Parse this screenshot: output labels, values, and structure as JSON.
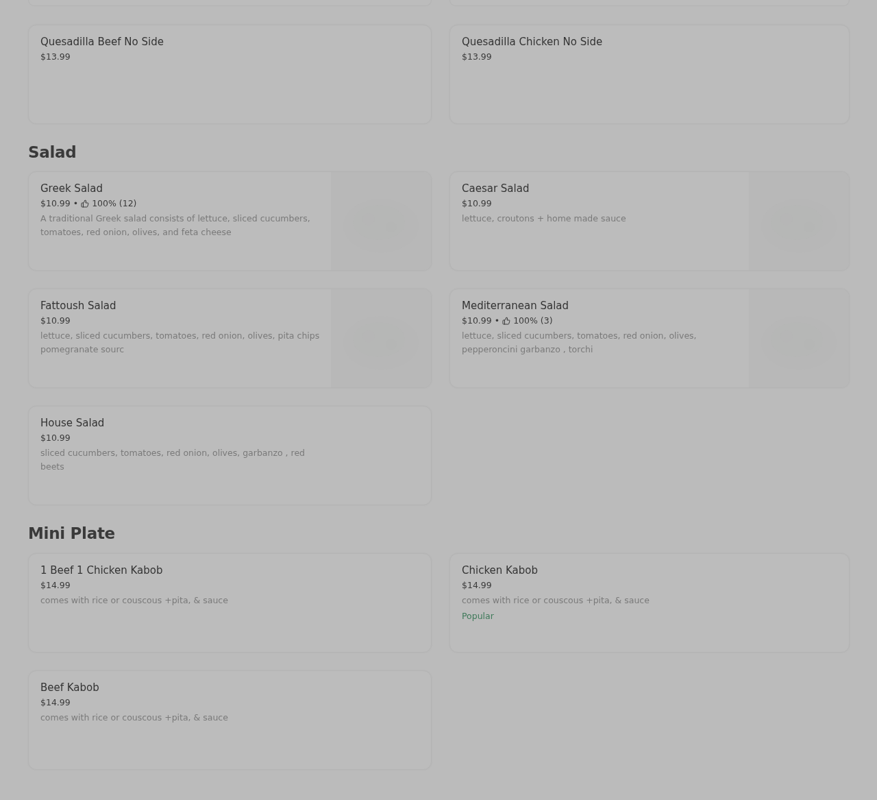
{
  "sections": [
    {
      "items": [
        {
          "name": "Quesadilla Beef No Side",
          "price": "$13.99"
        },
        {
          "name": "Quesadilla Chicken No Side",
          "price": "$13.99"
        }
      ]
    },
    {
      "title": "Salad",
      "items": [
        {
          "name": "Greek Salad",
          "price": "$10.99",
          "rating": {
            "separator": "•",
            "score": "100% (12)"
          },
          "description": "A traditional Greek salad consists of lettuce, sliced cucumbers, tomatoes, red onion, olives, and feta cheese"
        },
        {
          "name": "Caesar Salad",
          "price": "$10.99",
          "description": "lettuce, croutons + home made sauce"
        },
        {
          "name": "Fattoush Salad",
          "price": "$10.99",
          "description": "lettuce, sliced cucumbers, tomatoes, red onion, olives, pita chips pomegranate sourc"
        },
        {
          "name": "Mediterranean Salad",
          "price": "$10.99",
          "rating": {
            "separator": "•",
            "score": "100% (3)"
          },
          "description": "lettuce, sliced cucumbers, tomatoes, red onion, olives, pepperoncini garbanzo , torchi"
        },
        {
          "name": "House Salad",
          "price": "$10.99",
          "description": "sliced cucumbers, tomatoes, red onion, olives, garbanzo , red beets"
        }
      ]
    },
    {
      "title": "Mini Plate",
      "items": [
        {
          "name": "1 Beef 1 Chicken Kabob",
          "price": "$14.99",
          "description": "comes with rice or couscous +pita, & sauce"
        },
        {
          "name": "Chicken Kabob",
          "price": "$14.99",
          "description": "comes with rice or couscous +pita, & sauce",
          "badge": "Popular"
        },
        {
          "name": "Beef Kabob",
          "price": "$14.99",
          "description": "comes with rice or couscous +pita, & sauce"
        }
      ]
    }
  ]
}
